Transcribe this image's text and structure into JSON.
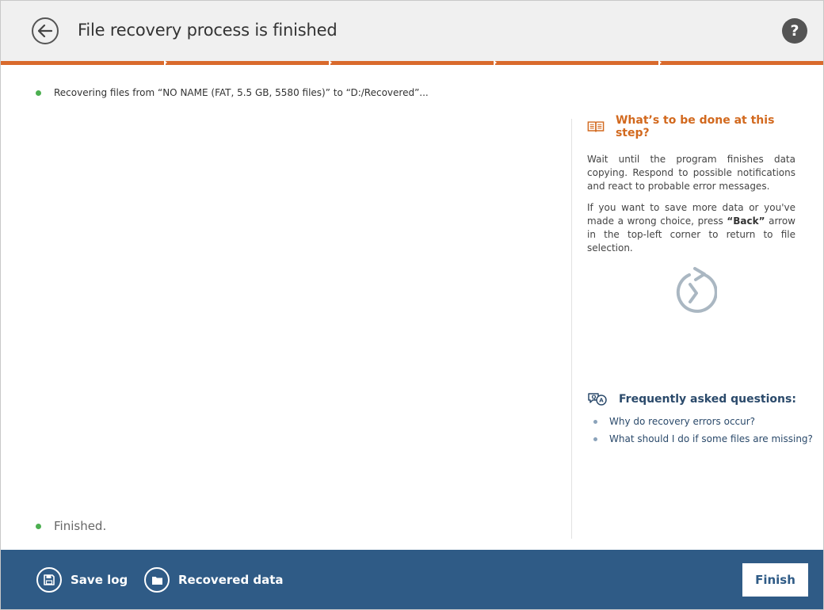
{
  "header": {
    "title": "File recovery process is finished",
    "help_label": "?"
  },
  "steps": {
    "count": 5,
    "completed": 5,
    "color": "#d96a2c"
  },
  "status": {
    "recovering": "Recovering files from “NO NAME (FAT, 5.5 GB, 5580 files)” to “D:/Recovered”...",
    "finished": "Finished."
  },
  "help": {
    "heading": "What’s to be done at this step?",
    "paragraph1": "Wait until the program finishes data copying. Respond to possible notifications and react to probable error messages.",
    "paragraph2_before": "If you want to save more data or you've made a wrong choice, press ",
    "paragraph2_bold": "“Back”",
    "paragraph2_after": " arrow in the top-left corner to return to file selection."
  },
  "faq": {
    "heading": "Frequently asked questions:",
    "items": [
      "Why do recovery errors occur?",
      "What should I do if some files are missing?"
    ]
  },
  "footer": {
    "save_log": "Save log",
    "recovered_data": "Recovered data",
    "finish": "Finish"
  },
  "colors": {
    "accent": "#d96a2c",
    "footer_bg": "#2f5b86",
    "status_ok": "#4caf50",
    "faq_text": "#2b4a6b"
  }
}
